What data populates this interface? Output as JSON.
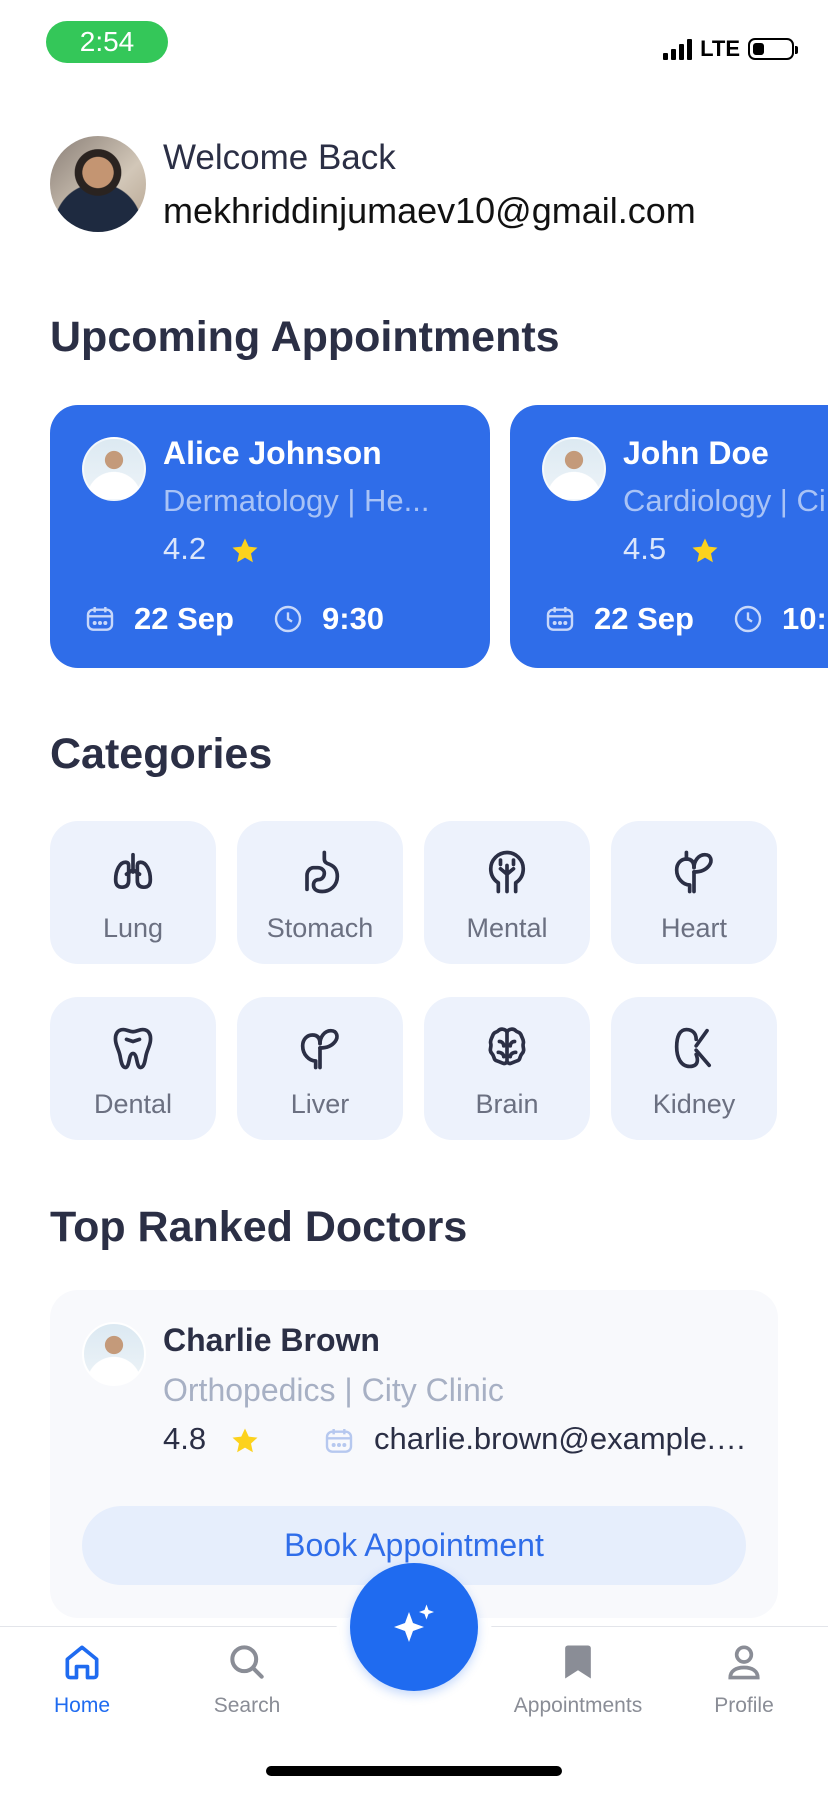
{
  "status_bar": {
    "time": "2:54",
    "network": "LTE"
  },
  "header": {
    "welcome": "Welcome Back",
    "email": "mekhriddinjumaev10@gmail.com"
  },
  "upcoming": {
    "title": "Upcoming Appointments",
    "cards": [
      {
        "name": "Alice Johnson",
        "specialty": "Dermatology | He...",
        "rating": "4.2",
        "date": "22 Sep",
        "time": "9:30"
      },
      {
        "name": "John Doe",
        "specialty": "Cardiology | Ci",
        "rating": "4.5",
        "date": "22 Sep",
        "time": "10:"
      }
    ]
  },
  "categories": {
    "title": "Categories",
    "items": [
      {
        "label": "Lung",
        "icon": "lung-icon"
      },
      {
        "label": "Stomach",
        "icon": "stomach-icon"
      },
      {
        "label": "Mental",
        "icon": "mental-icon"
      },
      {
        "label": "Heart",
        "icon": "heart-organ-icon"
      },
      {
        "label": "Dental",
        "icon": "tooth-icon"
      },
      {
        "label": "Liver",
        "icon": "liver-icon"
      },
      {
        "label": "Brain",
        "icon": "brain-icon"
      },
      {
        "label": "Kidney",
        "icon": "kidney-icon"
      }
    ]
  },
  "top_doctors": {
    "title": "Top Ranked Doctors",
    "doctor": {
      "name": "Charlie Brown",
      "specialty": "Orthopedics | City Clinic",
      "rating": "4.8",
      "email": "charlie.brown@example.com",
      "button": "Book Appointment"
    }
  },
  "nav": {
    "items": [
      {
        "label": "Home",
        "icon": "home-icon",
        "active": true
      },
      {
        "label": "Search",
        "icon": "search-icon",
        "active": false
      },
      {
        "label": "Appointments",
        "icon": "bookmark-icon",
        "active": false
      },
      {
        "label": "Profile",
        "icon": "profile-icon",
        "active": false
      }
    ],
    "fab_icon": "sparkles-icon"
  },
  "colors": {
    "primary": "#2f6de9",
    "fab": "#1f6bf0",
    "star": "#fcd21d",
    "tile_bg": "#edf2fc",
    "status_green": "#34c759"
  }
}
